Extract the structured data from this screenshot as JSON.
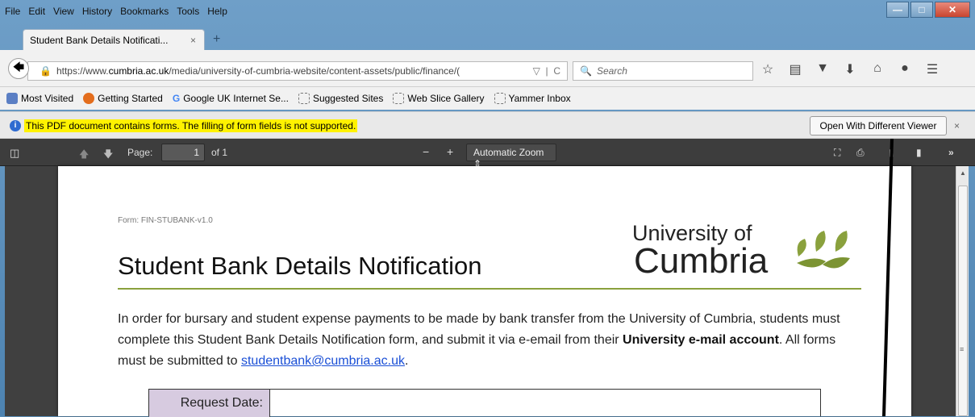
{
  "menu": [
    "File",
    "Edit",
    "View",
    "History",
    "Bookmarks",
    "Tools",
    "Help"
  ],
  "tab": {
    "title": "Student Bank Details Notificati...",
    "close": "×",
    "new": "+"
  },
  "url": {
    "prefix": "https://www.",
    "domain": "cumbria.ac.uk",
    "rest": "/media/university-of-cumbria-website/content-assets/public/finance/(",
    "dropdown": "▽",
    "reload": "C"
  },
  "search_placeholder": "Search",
  "bookmarks": [
    {
      "label": "Most Visited",
      "icon": "most-visited-icon",
      "color": "#5b7fc4"
    },
    {
      "label": "Getting Started",
      "icon": "firefox-icon",
      "color": "#e36d1d"
    },
    {
      "label": "Google UK Internet Se...",
      "icon": "google-icon",
      "color": "#ffffff"
    },
    {
      "label": "Suggested Sites",
      "icon": "page-icon",
      "color": "#ffffff"
    },
    {
      "label": "Web Slice Gallery",
      "icon": "page-icon",
      "color": "#ffffff"
    },
    {
      "label": "Yammer Inbox",
      "icon": "page-icon",
      "color": "#ffffff"
    }
  ],
  "notification": {
    "message": "This PDF document contains forms. The filling of form fields is not supported.",
    "button": "Open With Different Viewer",
    "close": "×"
  },
  "pdf_toolbar": {
    "page_label": "Page:",
    "page_value": "1",
    "of": "of 1",
    "zoom": "Automatic Zoom"
  },
  "document": {
    "form_id": "Form: FIN-STUBANK-v1.0",
    "title": "Student Bank Details Notification",
    "logo_line1": "University of",
    "logo_line2": "Cumbria",
    "para_part1": "In order for bursary and student expense payments to be made by bank transfer from the University of Cumbria, students must complete this Student Bank Details Notification form, and submit it via e-email from their ",
    "para_bold": "University e-mail account",
    "para_part2": ".  All forms must be submitted to ",
    "email": "studentbank@cumbria.ac.uk",
    "para_end": ".",
    "request_label": "Request Date:"
  },
  "colors": {
    "accent_rule": "#8aa13d",
    "highlight": "#fff200",
    "link": "#1a4fd6"
  }
}
